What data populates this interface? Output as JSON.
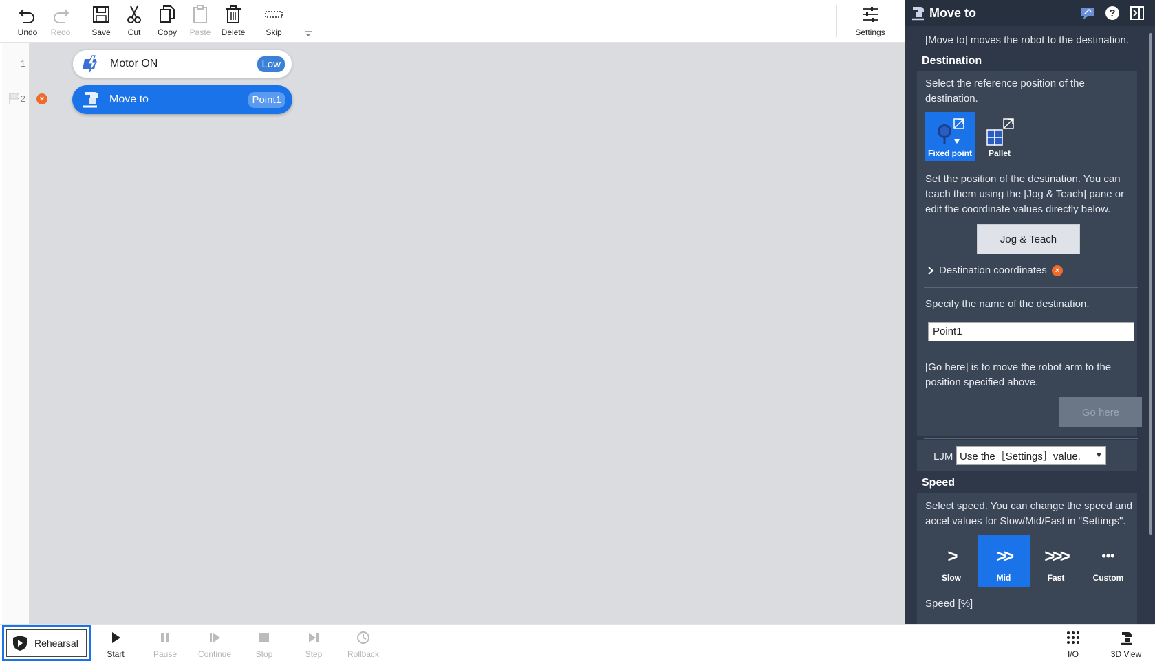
{
  "toolbar": {
    "undo": "Undo",
    "redo": "Redo",
    "save": "Save",
    "cut": "Cut",
    "copy": "Copy",
    "paste": "Paste",
    "delete": "Delete",
    "skip": "Skip",
    "settings": "Settings"
  },
  "program": {
    "lines": [
      {
        "number": "1",
        "label": "Motor ON",
        "badge": "Low"
      },
      {
        "number": "2",
        "label": "Move to",
        "badge": "Point1",
        "error": "×"
      }
    ]
  },
  "bottombar": {
    "rehearsal": "Rehearsal",
    "start": "Start",
    "pause": "Pause",
    "continue": "Continue",
    "stop": "Stop",
    "step": "Step",
    "rollback": "Rollback",
    "io": "I/O",
    "view3d": "3D View"
  },
  "panel": {
    "title": "Move to",
    "description": "[Move to] moves the robot to the destination.",
    "destination": {
      "heading": "Destination",
      "ref_text": "Select the reference position of the destination.",
      "options": [
        {
          "label": "Fixed point",
          "selected": true
        },
        {
          "label": "Pallet",
          "selected": false
        }
      ],
      "set_text": "Set the position of the destination. You can teach them using the [Jog & Teach] pane or edit the coordinate values directly below.",
      "jog_button": "Jog & Teach",
      "coordinates_label": "Destination coordinates",
      "name_text": "Specify the name of the destination.",
      "name_value": "Point1",
      "gohere_text": "[Go here] is to move the robot arm to the position specified above.",
      "gohere_button": "Go here",
      "ljm_label": "LJM",
      "ljm_value": "Use the［Settings］value."
    },
    "speed": {
      "heading": "Speed",
      "text": "Select speed. You can change the speed and accel values for Slow/Mid/Fast in \"Settings\".",
      "options": [
        {
          "label": "Slow",
          "icon": ">",
          "selected": false
        },
        {
          "label": "Mid",
          "icon": ">>",
          "selected": true
        },
        {
          "label": "Fast",
          "icon": ">>>",
          "selected": false
        },
        {
          "label": "Custom",
          "icon": "•••",
          "selected": false
        }
      ],
      "percent_label": "Speed [%]"
    }
  },
  "colors": {
    "accent": "#1a73e8",
    "panel_bg": "#2e3848",
    "error": "#f06a2a"
  }
}
